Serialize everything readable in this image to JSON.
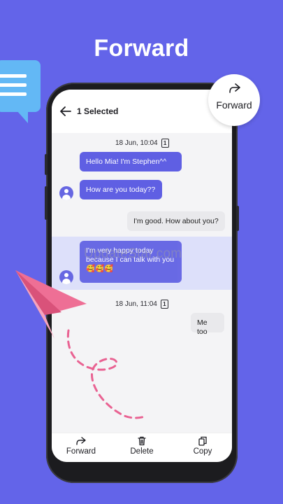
{
  "headline": "Forward",
  "header": {
    "title": "1 Selected"
  },
  "badge": {
    "label": "Forward"
  },
  "messages": [
    {
      "type": "date",
      "text": "18 Jun, 10:04",
      "count": "1"
    },
    {
      "type": "in",
      "text": "Hello Mia! I'm Stephen^^"
    },
    {
      "type": "in",
      "text": "How are you today??"
    },
    {
      "type": "out",
      "text": "I'm good. How about you?"
    },
    {
      "type": "in",
      "text": "I'm very happy today because I can talk with you 🥰🥰🥰"
    },
    {
      "type": "date",
      "text": "18 Jun, 11:04",
      "count": "1"
    },
    {
      "type": "out",
      "text": "Me too"
    }
  ],
  "watermark": "UpdateStar.com",
  "actions": {
    "forward": "Forward",
    "delete": "Delete",
    "copy": "Copy"
  },
  "colors": {
    "background": "#6364e9",
    "incoming_bubble": "#5f5fe3",
    "selected_row": "#dde0fa",
    "plane": "#ee6f95"
  }
}
